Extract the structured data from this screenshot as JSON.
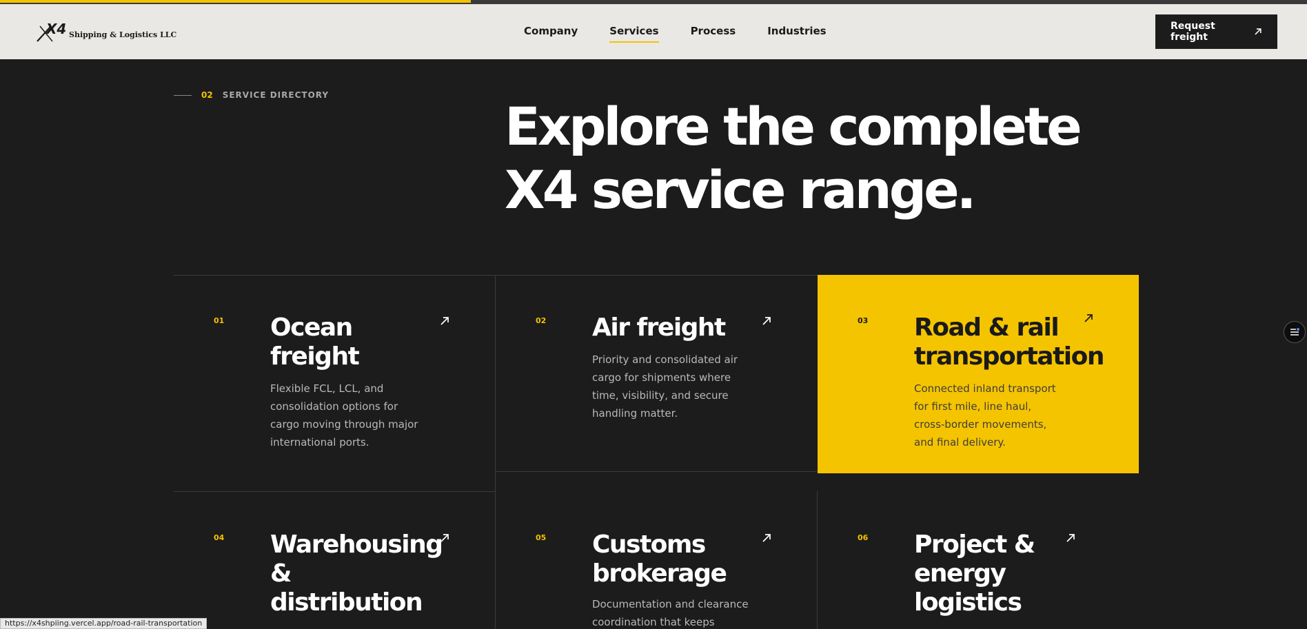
{
  "brand": {
    "logo_mark": "X4",
    "name": "Shipping & Logistics LLC"
  },
  "page_progress": 0.36,
  "nav": {
    "items": [
      {
        "label": "Company",
        "active": false
      },
      {
        "label": "Services",
        "active": true
      },
      {
        "label": "Process",
        "active": false
      },
      {
        "label": "Industries",
        "active": false
      }
    ],
    "cta_label": "Request freight",
    "cta_icon": "arrow-up-right-icon"
  },
  "section": {
    "number": "02",
    "label": "SERVICE DIRECTORY",
    "heading_line1": "Explore the complete",
    "heading_line2": "X4 service range."
  },
  "services": [
    {
      "num": "01",
      "title": "Ocean freight",
      "desc": "Flexible FCL, LCL, and consolidation options for cargo moving through major international ports.",
      "highlighted": false
    },
    {
      "num": "02",
      "title": "Air freight",
      "desc": "Priority and consolidated air cargo for shipments where time, visibility, and secure handling matter.",
      "highlighted": false
    },
    {
      "num": "03",
      "title": "Road & rail transportation",
      "desc": "Connected inland transport for first mile, line haul, cross-border movements, and final delivery.",
      "highlighted": true
    },
    {
      "num": "04",
      "title": "Warehousing & distribution",
      "desc": "",
      "highlighted": false
    },
    {
      "num": "05",
      "title": "Customs brokerage",
      "desc": "Documentation and clearance coordination that keeps",
      "highlighted": false
    },
    {
      "num": "06",
      "title": "Project & energy logistics",
      "desc": "",
      "highlighted": false
    }
  ],
  "colors": {
    "accent": "#f5c200",
    "background": "#1c1c1c",
    "header_bg": "#e9e8e4"
  },
  "side_widget_icon": "menu-lines-icon",
  "status_url": "https://x4shpiing.vercel.app/road-rail-transportation"
}
